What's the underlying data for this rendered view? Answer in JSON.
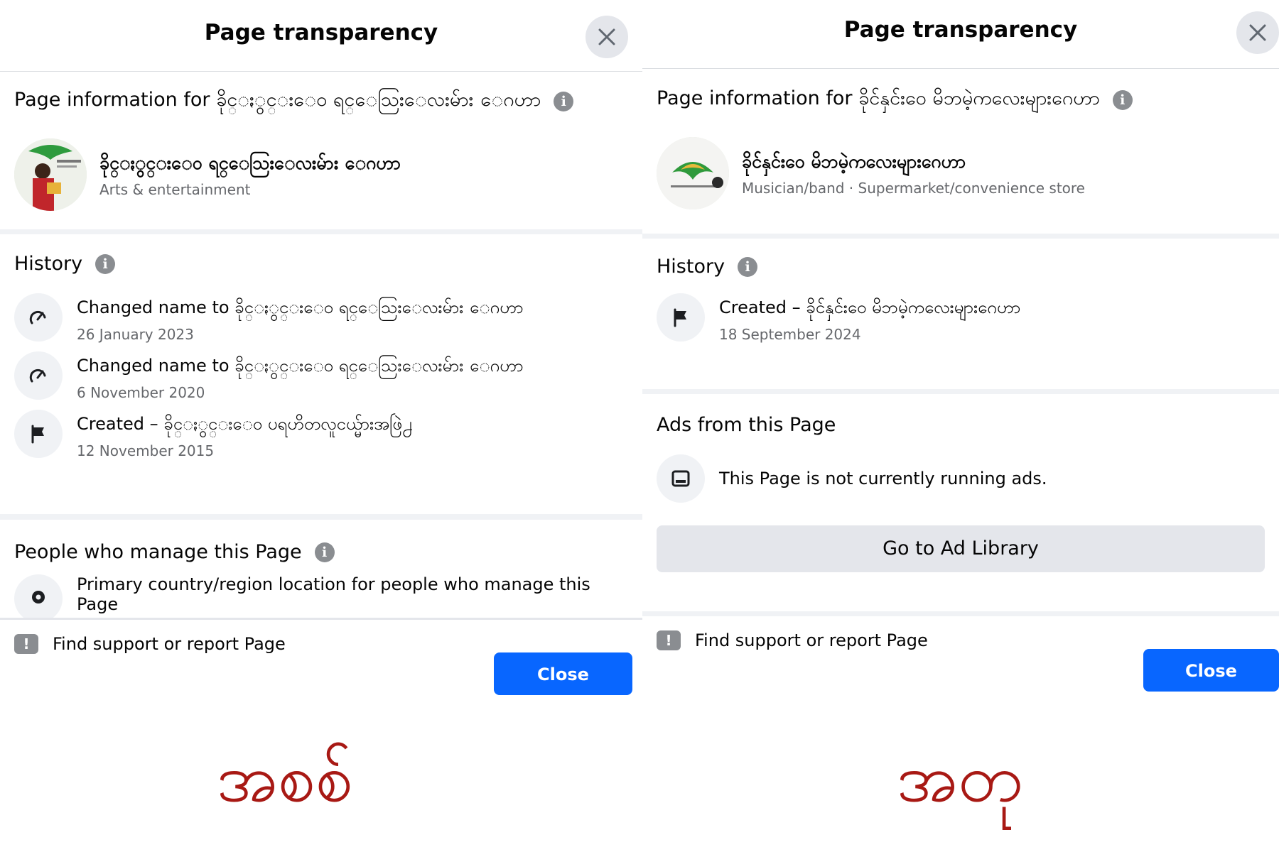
{
  "left": {
    "header_title": "Page transparency",
    "page_info_title": "Page information for ခိုင္ႏွင္းေဝ ရင္ေသြးေလးမ်ား ေဂဟာ",
    "profile": {
      "name": "ခိုင္ႏွင္းေဝ ရင္ေသြးေလးမ်ား ေဂဟာ",
      "category": "Arts & entertainment"
    },
    "history_title": "History",
    "history": [
      {
        "icon": "name-change-icon",
        "text": "Changed name to ခိုင္ႏွင္းေဝ ရင္ေသြးေလးမ်ား ေဂဟာ",
        "date": "26 January 2023"
      },
      {
        "icon": "name-change-icon",
        "text": "Changed name to ခိုင္ႏွင္းေဝ ရင္ေသြးေလးမ်ား ေဂဟာ",
        "date": "6 November 2020"
      },
      {
        "icon": "flag-icon",
        "text": "Created – ခိုင္ႏွင္းေဝ ပရဟိတလူငယ္မ်ားအဖြဲ႕",
        "date": "12 November 2015"
      }
    ],
    "managers_title": "People who manage this Page",
    "managers_item": "Primary country/region location for people who manage this Page",
    "support_text": "Find support or report Page",
    "close_label": "Close",
    "caption": "အစစ်"
  },
  "right": {
    "header_title": "Page transparency",
    "page_info_title": "Page information for ခိုင်နှင်းဝေ မိဘမဲ့ကလေးများဂေဟာ",
    "profile": {
      "name": "ခိုင်နှင်းဝေ မိဘမဲ့ကလေးများဂေဟာ",
      "category": "Musician/band · Supermarket/convenience store"
    },
    "history_title": "History",
    "history": [
      {
        "icon": "flag-icon",
        "text": "Created – ခိုင်နှင်းဝေ မိဘမဲ့ကလေးများဂေဟာ",
        "date": "18 September 2024"
      }
    ],
    "ads_title": "Ads from this Page",
    "ads_text": "This Page is not currently running ads.",
    "ad_library_label": "Go to Ad Library",
    "support_text": "Find support or report Page",
    "close_label": "Close",
    "caption": "အတု"
  },
  "colors": {
    "primary_button": "#0866ff",
    "caption": "#a81914",
    "secondary_text": "#65676b",
    "gray_button": "#e4e6eb"
  }
}
